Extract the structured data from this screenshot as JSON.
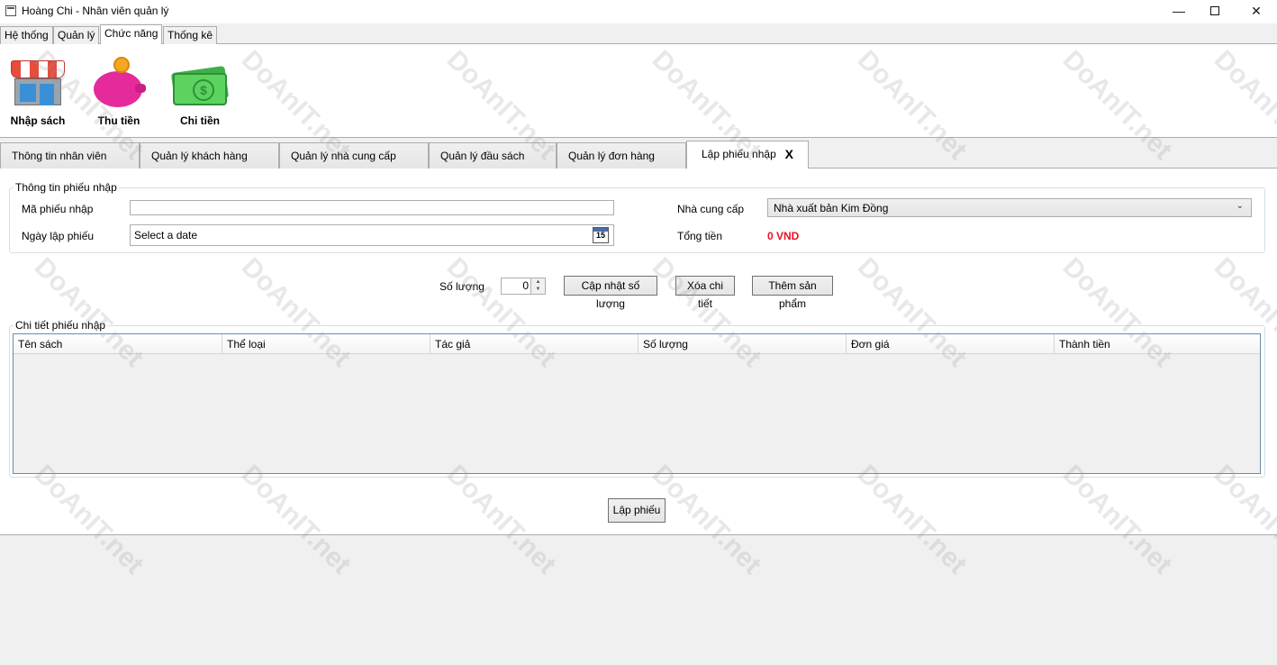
{
  "window": {
    "title": "Hoàng Chi - Nhân viên quản lý",
    "minimize_glyph": "—",
    "close_glyph": "✕"
  },
  "ribbon_tabs": [
    "Hệ thống",
    "Quản lý",
    "Chức năng",
    "Thống kê"
  ],
  "ribbon_active_tab": "Chức năng",
  "ribbon_buttons": [
    {
      "label": "Nhập sách",
      "icon": "store-icon"
    },
    {
      "label": "Thu tiền",
      "icon": "piggy-bank-icon"
    },
    {
      "label": "Chi tiền",
      "icon": "money-icon"
    }
  ],
  "doc_tabs": [
    "Thông tin nhân viên",
    "Quản lý khách hàng",
    "Quản lý nhà cung cấp",
    "Quản lý đầu sách",
    "Quản lý đơn hàng",
    "Lập phiếu nhập"
  ],
  "doc_active_tab": "Lập phiếu nhập",
  "doc_tab_close": "X",
  "form": {
    "group_title": "Thông tin phiếu nhập",
    "ma_phieu_label": "Mã phiếu nhập",
    "ma_phieu_value": "",
    "ngay_lap_label": "Ngày lập phiếu",
    "ngay_lap_placeholder": "Select a date",
    "calendar_day": "15",
    "nha_cung_cap_label": "Nhà cung cấp",
    "nha_cung_cap_value": "Nhà xuất bản Kim Đồng",
    "tong_tien_label": "Tổng tiền",
    "tong_tien_value": "0 VND",
    "total_color": "#e81123"
  },
  "actions": {
    "so_luong_label": "Số lượng",
    "so_luong_value": "0",
    "cap_nhat_label": "Cập nhật số lượng",
    "xoa_chi_tiet_label": "Xóa chi tiết",
    "them_san_pham_label": "Thêm sản phẩm"
  },
  "details": {
    "group_title": "Chi tiết phiếu nhập",
    "columns": [
      "Tên sách",
      "Thể loại",
      "Tác giả",
      "Số lượng",
      "Đơn giá",
      "Thành tiền"
    ]
  },
  "submit_label": "Lập phiếu",
  "watermark": "DoAnIT.net"
}
